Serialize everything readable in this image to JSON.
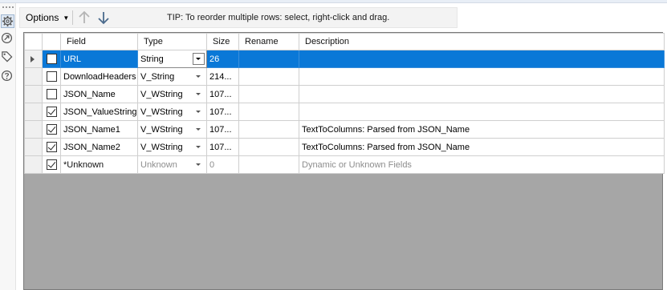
{
  "toolbar": {
    "options_label": "Options",
    "tip": "TIP: To reorder multiple rows: select, right-click and drag."
  },
  "left_rail": {
    "icons": [
      "gear-icon",
      "connections-icon",
      "tag-icon",
      "help-icon"
    ]
  },
  "grid": {
    "columns": [
      "Field",
      "Type",
      "Size",
      "Rename",
      "Description"
    ],
    "rows": [
      {
        "checked": false,
        "field": "URL",
        "type": "String",
        "size": "26",
        "rename": "",
        "description": ""
      },
      {
        "checked": false,
        "field": "DownloadHeaders",
        "type": "V_String",
        "size": "214...",
        "rename": "",
        "description": ""
      },
      {
        "checked": false,
        "field": "JSON_Name",
        "type": "V_WString",
        "size": "107...",
        "rename": "",
        "description": ""
      },
      {
        "checked": true,
        "field": "JSON_ValueString",
        "type": "V_WString",
        "size": "107...",
        "rename": "",
        "description": ""
      },
      {
        "checked": true,
        "field": "JSON_Name1",
        "type": "V_WString",
        "size": "107...",
        "rename": "",
        "description": "TextToColumns: Parsed from JSON_Name"
      },
      {
        "checked": true,
        "field": "JSON_Name2",
        "type": "V_WString",
        "size": "107...",
        "rename": "",
        "description": "TextToColumns: Parsed from JSON_Name"
      },
      {
        "checked": true,
        "field": "*Unknown",
        "type": "Unknown",
        "size": "0",
        "rename": "",
        "description": "Dynamic or Unknown Fields"
      }
    ]
  },
  "colors": {
    "selection": "#0a78d7",
    "empty_area": "#a6a6a6"
  }
}
